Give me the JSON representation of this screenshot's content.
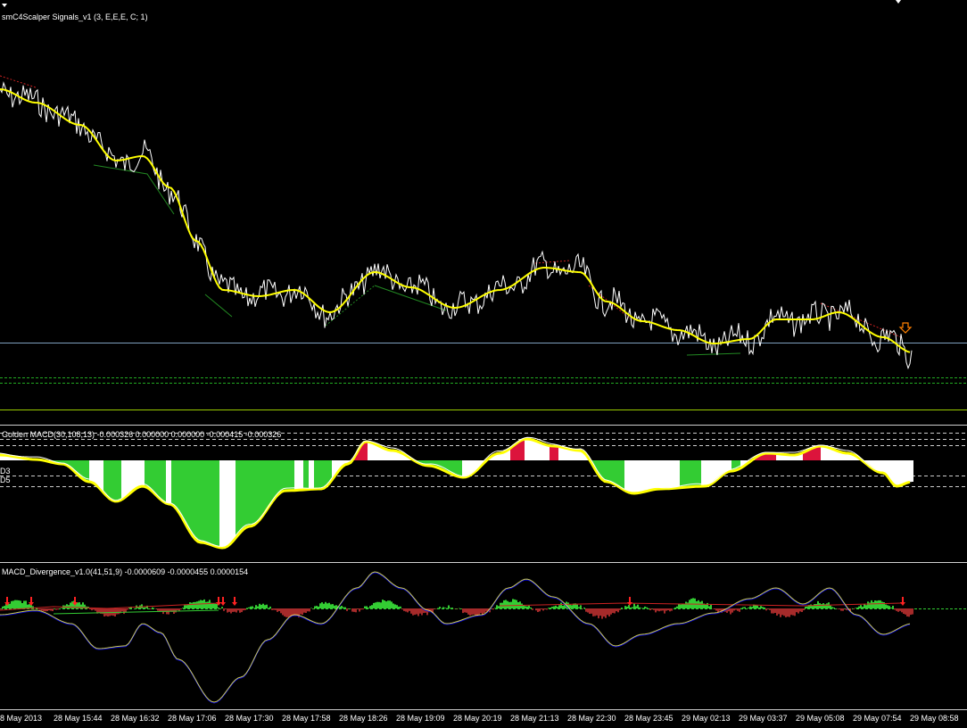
{
  "main_indicator_label": "smC4Scalper Signals_v1 (3, E,E,E, C; 1)",
  "macd_indicator_label": "Golden MACD(30,108,13) -0.000326 0.000000 0.000000 -0.000415 -0.000326",
  "divergence_indicator_label": "MACD_Divergence_v1.0(41,51,9) -0.0000609 -0.0000455 0.0000154",
  "macd_level_labels": [
    "D3",
    "D5"
  ],
  "time_axis": [
    "8 May 2013",
    "28 May 15:44",
    "28 May 16:32",
    "28 May 17:06",
    "28 May 17:30",
    "28 May 17:58",
    "28 May 18:26",
    "28 May 19:09",
    "28 May 20:19",
    "28 May 21:13",
    "28 May 22:30",
    "28 May 23:45",
    "29 May 02:13",
    "29 May 03:37",
    "29 May 05:08",
    "29 May 07:54",
    "29 May 08:58"
  ],
  "colors": {
    "background": "#000000",
    "price_line": "#ffffff",
    "moving_average": "#ffff00",
    "histogram_up": "#33cc33",
    "histogram_neutral": "#ffffff",
    "histogram_red": "#dc143c",
    "signal_arrow": "#ff8000",
    "divergence_line": "#0000cd",
    "divergence_hist_up": "#33cc33",
    "divergence_hist_down": "#a52a2a",
    "current_price_line": "#7f9fbf"
  },
  "icons": {
    "sell_signal": "down-arrow-icon",
    "divergence_marker": "red-arrow-icon",
    "window_menu": "down-triangle-icon"
  }
}
